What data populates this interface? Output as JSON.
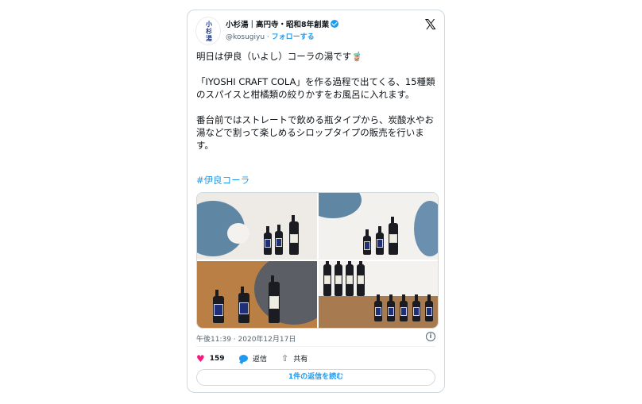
{
  "account": {
    "display_name": "小杉湯｜高円寺・昭和8年創業",
    "handle": "@kosugiyu",
    "follow_label": "フォローする",
    "avatar_text": "小杉湯"
  },
  "tweet": {
    "text": "明日は伊良（いよし）コーラの湯です🧋\n\n「IYOSHI CRAFT COLA」を作る過程で出てくる、15種類のスパイスと柑橘類の絞りかすをお風呂に入れます。\n\n番台前ではストレートで飲める瓶タイプから、炭酸水やお湯などで割って楽しめるシロップタイプの販売を行います。",
    "hashtag": "#伊良コーラ",
    "timestamp": "午後11:39 · 2020年12月17日"
  },
  "actions": {
    "like_count": "159",
    "reply_label": "返信",
    "share_label": "共有",
    "read_replies_label": "1件の返信を読む"
  },
  "icons": {
    "x_logo": "x-logo-icon",
    "verified": "verified-badge-icon",
    "heart": "heart-icon",
    "reply": "reply-bubble-icon",
    "share": "share-icon",
    "info": "info-icon"
  },
  "colors": {
    "accent": "#1d9bf0",
    "like": "#f91880",
    "muted": "#536471",
    "border": "#cfd9de"
  }
}
